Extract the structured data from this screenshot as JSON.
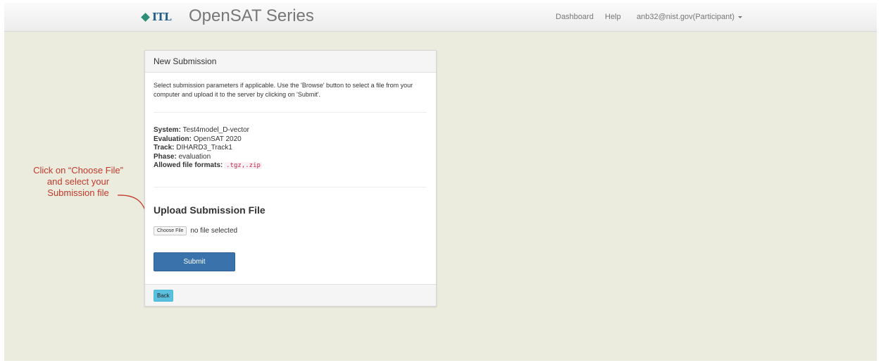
{
  "navbar": {
    "logo_text": "ITL",
    "brand": "OpenSAT Series",
    "links": {
      "dashboard": "Dashboard",
      "help": "Help",
      "user": "anb32@nist.gov(Participant)"
    }
  },
  "panel": {
    "heading": "New Submission",
    "instructions": "Select submission parameters if applicable. Use the 'Browse' button to select a file from your computer and upload it to the server by clicking on 'Submit'.",
    "info": {
      "system_label": "System:",
      "system_value": "Test4model_D-vector",
      "evaluation_label": "Evaluation:",
      "evaluation_value": "OpenSAT 2020",
      "track_label": "Track:",
      "track_value": "DIHARD3_Track1",
      "phase_label": "Phase:",
      "phase_value": "evaluation",
      "formats_label": "Allowed file formats:",
      "formats_value": ".tgz,.zip"
    },
    "upload_title": "Upload Submission File",
    "choose_file_label": "Choose File",
    "file_status": "no file selected",
    "submit_label": "Submit",
    "back_label": "Back"
  },
  "annotation": {
    "line1": "Click on “Choose File”",
    "line2": "and select your",
    "line3": "Submission file"
  },
  "colors": {
    "page_bg": "#ebebde",
    "submit": "#3a72ab",
    "back": "#5bc0de",
    "annotation": "#c0392b"
  }
}
